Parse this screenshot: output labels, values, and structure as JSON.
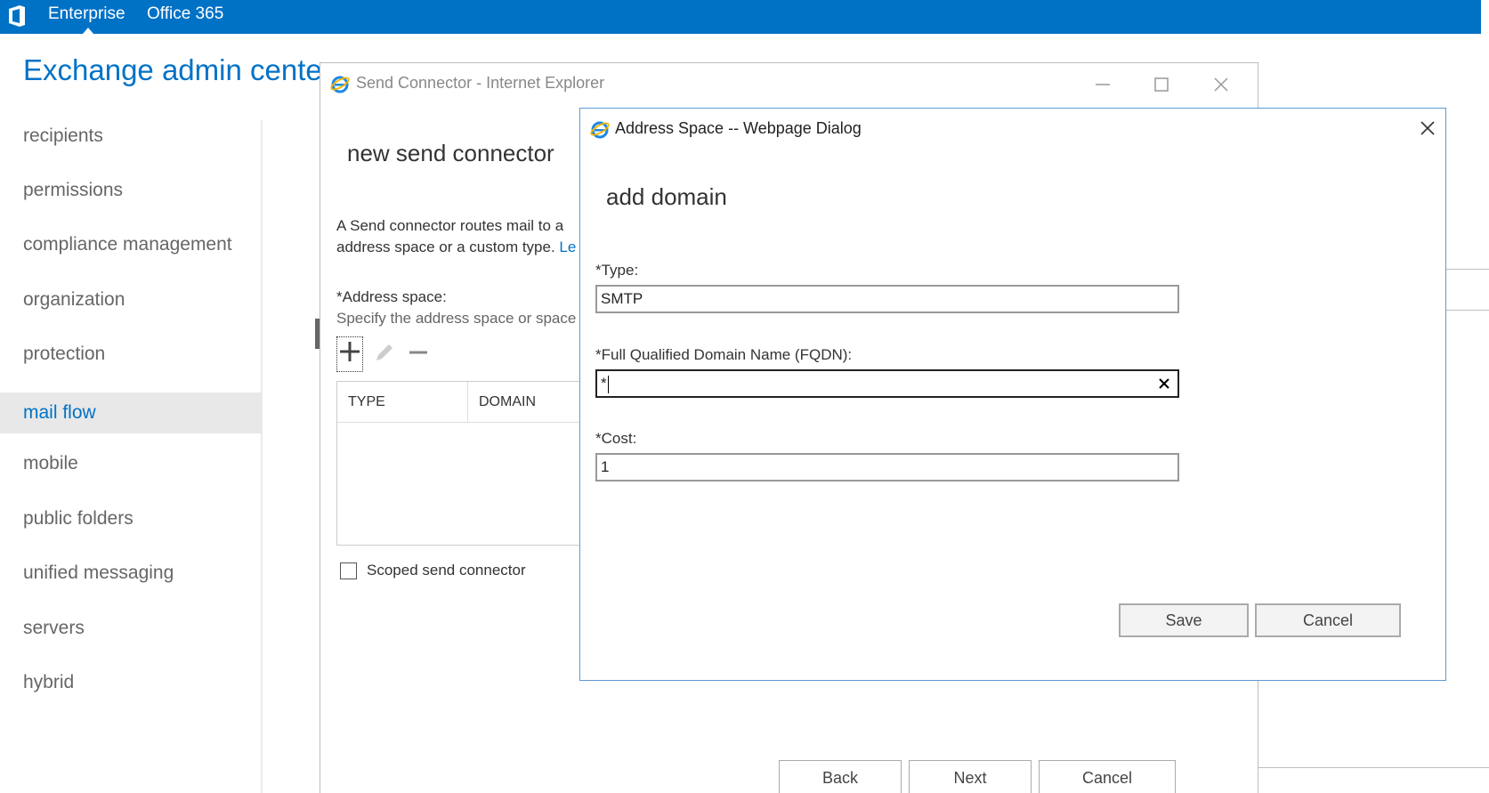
{
  "topbar": {
    "nav": [
      "Enterprise",
      "Office 365"
    ],
    "accent": "#0072c6"
  },
  "eac": {
    "title": "Exchange admin center",
    "nav_items": [
      {
        "label": "recipients"
      },
      {
        "label": "permissions"
      },
      {
        "label": "compliance management"
      },
      {
        "label": "organization"
      },
      {
        "label": "protection"
      },
      {
        "label": "mail flow",
        "active": true
      },
      {
        "label": "mobile"
      },
      {
        "label": "public folders"
      },
      {
        "label": "unified messaging"
      },
      {
        "label": "servers"
      },
      {
        "label": "hybrid"
      }
    ]
  },
  "ie_window": {
    "title": "Send Connector - Internet Explorer",
    "icon": "internet-explorer-icon",
    "heading": "new send connector",
    "description_line1": "A Send connector routes mail to a",
    "description_line2": "address space or a custom type.",
    "description_link": "Le",
    "address_space_label": "*Address space:",
    "address_space_help": "Specify the address space or space",
    "grid_columns": [
      "TYPE",
      "DOMAIN"
    ],
    "scoped_label": "Scoped send connector",
    "scoped_checked": false,
    "buttons": {
      "back": "Back",
      "next": "Next",
      "cancel": "Cancel"
    }
  },
  "dialog": {
    "title": "Address Space -- Webpage Dialog",
    "heading": "add domain",
    "type_label": "*Type:",
    "type_value": "SMTP",
    "fqdn_label": "*Full Qualified Domain Name (FQDN):",
    "fqdn_value": "*",
    "cost_label": "*Cost:",
    "cost_value": "1",
    "buttons": {
      "save": "Save",
      "cancel": "Cancel"
    }
  }
}
